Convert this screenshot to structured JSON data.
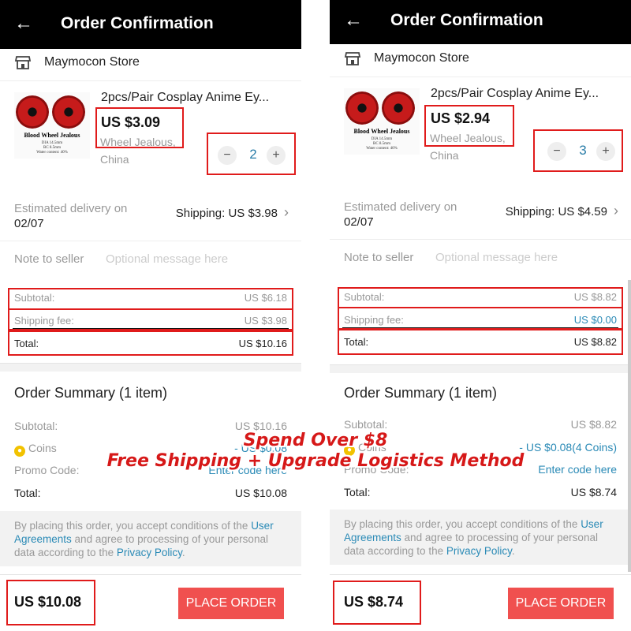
{
  "left": {
    "header": {
      "back_icon": "arrow-left-icon",
      "title": "Order Confirmation"
    },
    "store": {
      "icon": "store-icon",
      "name": "Maymocon Store"
    },
    "product": {
      "title": "2pcs/Pair Cosplay Anime Ey...",
      "price": "US $3.09",
      "variant": "Wheel  Jealous, China",
      "thumb_brand": "Blood Wheel Jealous",
      "thumb_specs": "DIA 14.5mm\nBC 8.5mm\nWater content: 40%",
      "qty_minus": "−",
      "qty": "2",
      "qty_plus": "+"
    },
    "delivery": {
      "label": "Estimated delivery on",
      "date": "02/07",
      "shipping": "Shipping: US $3.98",
      "chevron": "›"
    },
    "note": {
      "label": "Note to seller",
      "placeholder": "Optional message here"
    },
    "totals": {
      "subtotal_label": "Subtotal:",
      "subtotal": "US $6.18",
      "shipping_label": "Shipping fee:",
      "shipping": "US $3.98",
      "total_label": "Total:",
      "total": "US $10.16"
    },
    "summary": {
      "title": "Order Summary (1 item)",
      "subtotal_label": "Subtotal:",
      "subtotal": "US $10.16",
      "coins_label": "Coins",
      "coins": "- US $0.08",
      "promo_label": "Promo Code:",
      "promo": "Enter code here",
      "total_label": "Total:",
      "total": "US $10.08"
    },
    "terms": {
      "pre": "By placing this order, you accept conditions of the ",
      "link1": "User Agreements",
      "mid": " and agree to processing of your personal data according to the ",
      "link2": "Privacy Policy",
      "post": "."
    },
    "footer": {
      "amount": "US $10.08",
      "button": "PLACE ORDER"
    }
  },
  "right": {
    "header": {
      "back_icon": "arrow-left-icon",
      "title": "Order Confirmation"
    },
    "store": {
      "icon": "store-icon",
      "name": "Maymocon Store"
    },
    "product": {
      "title": "2pcs/Pair Cosplay Anime Ey...",
      "price": "US $2.94",
      "variant": "Wheel  Jealous, China",
      "thumb_brand": "Blood Wheel Jealous",
      "thumb_specs": "DIA 14.5mm\nBC 8.5mm\nWater content: 40%",
      "qty_minus": "−",
      "qty": "3",
      "qty_plus": "+"
    },
    "delivery": {
      "label": "Estimated delivery on",
      "date": "02/07",
      "shipping": "Shipping: US $4.59",
      "chevron": "›"
    },
    "note": {
      "label": "Note to seller",
      "placeholder": "Optional message here"
    },
    "totals": {
      "subtotal_label": "Subtotal:",
      "subtotal": "US $8.82",
      "shipping_label": "Shipping fee:",
      "shipping": "US $0.00",
      "total_label": "Total:",
      "total": "US $8.82"
    },
    "summary": {
      "title": "Order Summary (1 item)",
      "subtotal_label": "Subtotal:",
      "subtotal": "US $8.82",
      "coins_label": "Coins",
      "coins": "- US $0.08(4 Coins)",
      "promo_label": "Promo Code:",
      "promo": "Enter code here",
      "total_label": "Total:",
      "total": "US $8.74"
    },
    "terms": {
      "pre": "By placing this order, you accept conditions of the ",
      "link1": "User Agreements",
      "mid": " and agree to processing of your personal data according to the ",
      "link2": "Privacy Policy",
      "post": "."
    },
    "footer": {
      "amount": "US $8.74",
      "button": "PLACE ORDER"
    }
  },
  "overlay": {
    "line1": "Spend Over $8",
    "line2": "Free Shipping + Upgrade Logistics Method"
  },
  "colors": {
    "highlight": "#e01b1b",
    "accent": "#f0504f",
    "link": "#2a8ab6",
    "overlay_text": "#d61818"
  }
}
